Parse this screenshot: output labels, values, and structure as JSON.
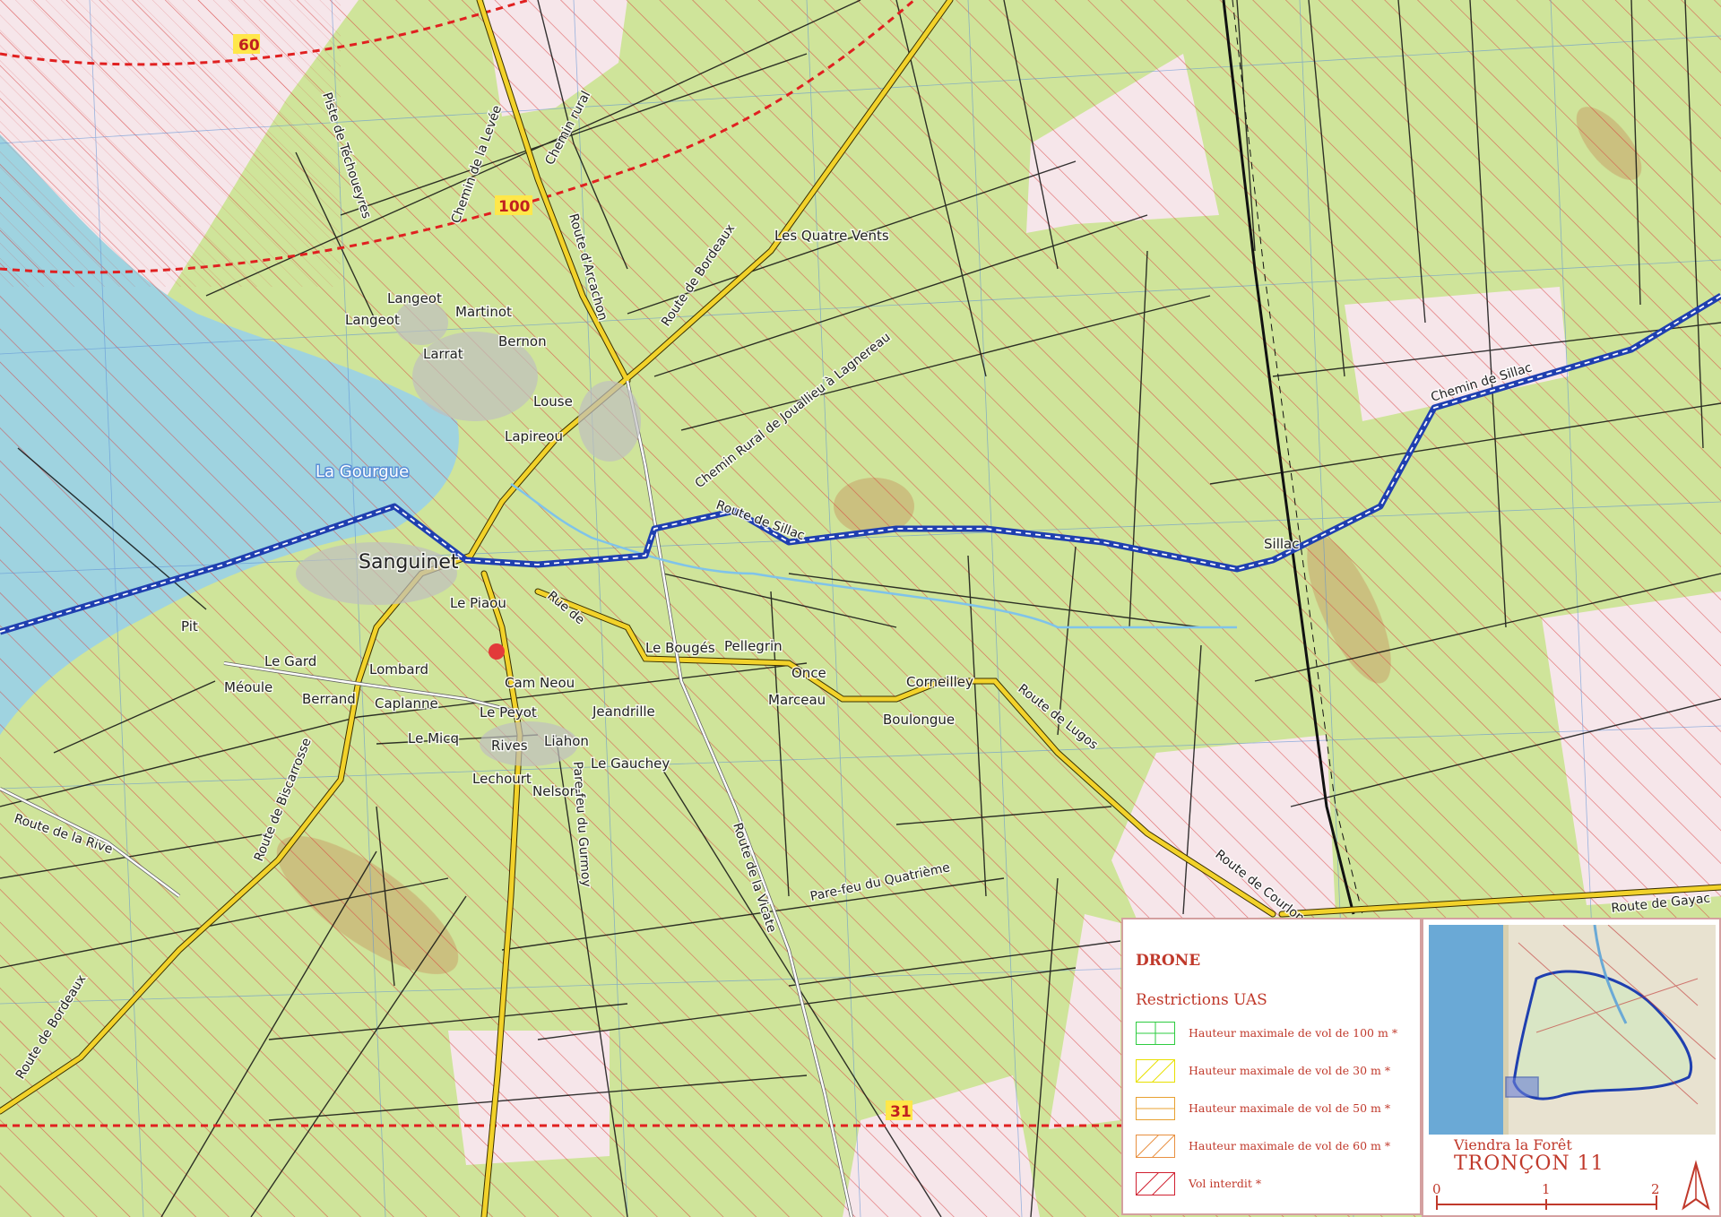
{
  "map": {
    "place_labels": {
      "sanguinet": "Sanguinet",
      "la_gourgue": "La Gourgue",
      "langeot1": "Langeot",
      "langeot2": "Langeot",
      "martinot": "Martinot",
      "bernon": "Bernon",
      "larrat": "Larrat",
      "louse": "Louse",
      "lapireou": "Lapireou",
      "les_quatre_vents": "Les Quatre Vents",
      "le_piaou": "Le Piaou",
      "pit": "Pit",
      "le_gard": "Le Gard",
      "lombard": "Lombard",
      "meoule": "Méoule",
      "berrand": "Berrand",
      "caplanne": "Caplanne",
      "cam_neou": "Cam Neou",
      "le_peyot": "Le Peyot",
      "le_micq": "Le Micq",
      "rives": "Rives",
      "liahon": "Liahon",
      "lechourt": "Lechourt",
      "nelson": "Nelson",
      "le_gauchey": "Le Gauchey",
      "jeandrille": "Jeandrille",
      "le_bouges": "Le Bougés",
      "pellegrin": "Pellegrin",
      "once": "Once",
      "marceau": "Marceau",
      "corneilley": "Corneilley",
      "boulongue": "Boulongue",
      "sillac": "Sillac"
    },
    "road_labels": {
      "piste_techoueyres": "Piste de Téchoueyres",
      "chemin_levee": "Chemin de la Levée",
      "chemin_rural": "Chemin rural",
      "route_arcachon": "Route d'Arcachon",
      "route_bordeaux_n": "Route de Bordeaux",
      "chemin_rural_jouallieu": "Chemin Rural de Jouallieu à Lagnereau",
      "route_sillac": "Route de Sillac",
      "chemin_sillac": "Chemin de Sillac",
      "rue_de": "Rue de",
      "route_lugos": "Route de Lugos",
      "route_courlon": "Route de Courlon",
      "route_gayac": "Route de Gayac",
      "route_biscarrosse": "Route de Biscarrosse",
      "route_la_rive": "Route de la Rive",
      "route_bordeaux_s": "Route de Bordeaux",
      "pare_feu_gurmoy": "Pare-feu du Gurmoy",
      "route_vicate": "Route de la Vicate",
      "pare_feu_quatrieme": "Pare-feu du Quatrième"
    },
    "altitude_labels": {
      "a60": "60",
      "a100": "100",
      "a31": "31"
    }
  },
  "legend": {
    "title": "DRONE",
    "subtitle": "Restrictions UAS",
    "items": [
      {
        "label": "Hauteur maximale de vol de 100 m *",
        "color": "#2ecc40"
      },
      {
        "label": "Hauteur maximale de vol de 30 m *",
        "color": "#e8e000"
      },
      {
        "label": "Hauteur maximale de vol de 50 m *",
        "color": "#e8a030"
      },
      {
        "label": "Hauteur maximale de vol de 60 m *",
        "color": "#e89040"
      },
      {
        "label": "Vol interdit *",
        "color": "#d02030"
      }
    ]
  },
  "inset": {
    "caption": "Viendra la Forêt",
    "title": "TRONÇON 11",
    "scale": [
      "0",
      "1",
      "2"
    ]
  },
  "colors": {
    "forest": "#cfe49a",
    "lake": "#9fd3e0",
    "hatch": "#d83a3a",
    "road": "#f2d22a",
    "trail": "#1f3fb0",
    "boundary": "#e02020"
  }
}
